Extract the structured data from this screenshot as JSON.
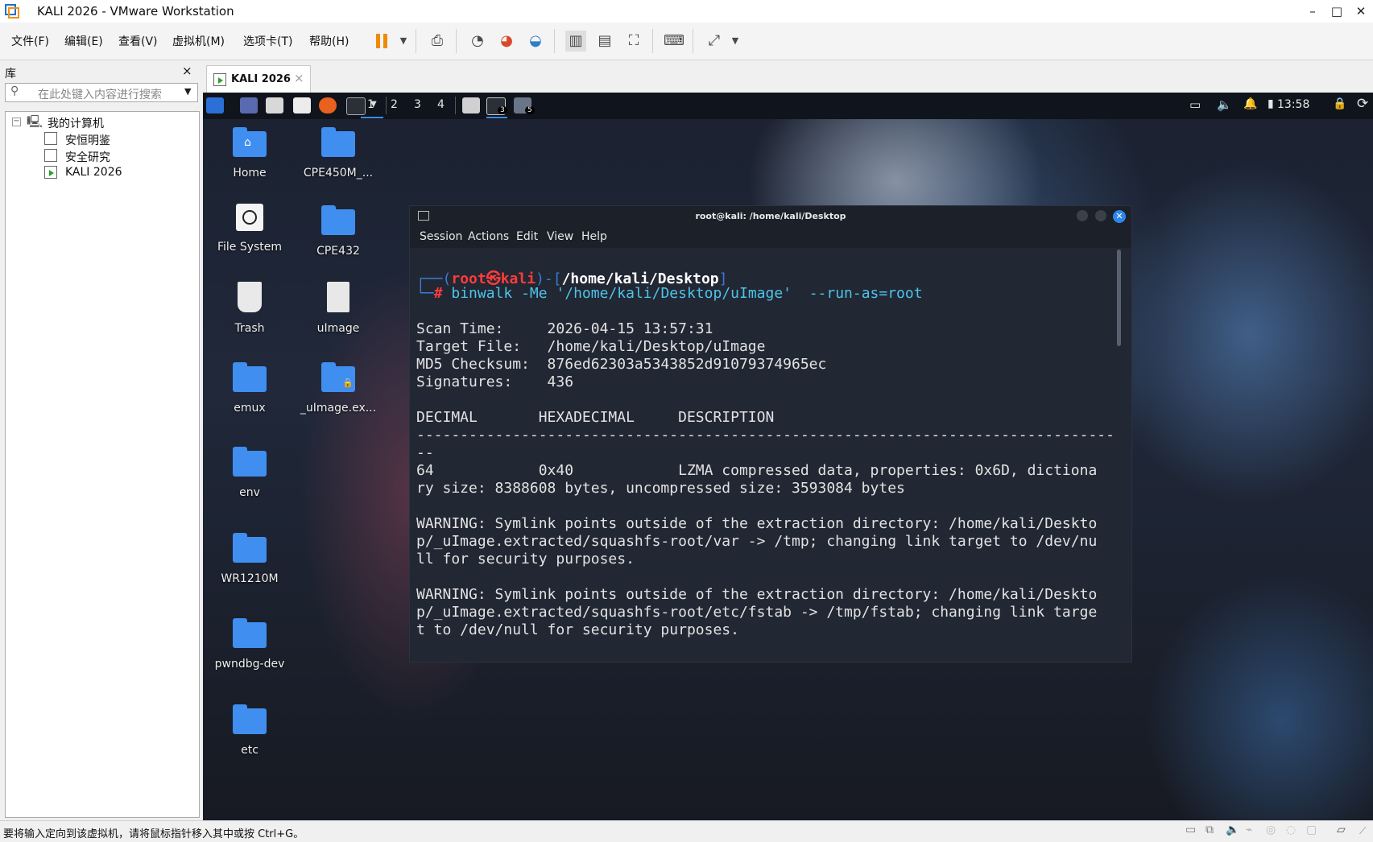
{
  "window": {
    "title": "KALI 2026 - VMware Workstation"
  },
  "menu": {
    "items": [
      "文件(F)",
      "编辑(E)",
      "查看(V)",
      "虚拟机(M)",
      "选项卡(T)",
      "帮助(H)"
    ]
  },
  "library": {
    "title": "库",
    "close": "×",
    "search_placeholder": "在此处键入内容进行搜索",
    "tree": {
      "root": "我的计算机",
      "children": [
        "安恒明鉴",
        "安全研究",
        "KALI 2026"
      ]
    }
  },
  "vm_tab": {
    "label": "KALI 2026",
    "close": "×"
  },
  "kali_panel": {
    "workspaces": [
      "1",
      "2",
      "3",
      "4"
    ],
    "clock": "13:58",
    "badges": [
      "3",
      "5"
    ]
  },
  "desktop_icons": [
    {
      "label": "Home"
    },
    {
      "label": "CPE450M_..."
    },
    {
      "label": "File System"
    },
    {
      "label": "CPE432"
    },
    {
      "label": "Trash"
    },
    {
      "label": "uImage"
    },
    {
      "label": "emux"
    },
    {
      "label": "_uImage.ex..."
    },
    {
      "label": "env"
    },
    {
      "label": "WR1210M"
    },
    {
      "label": "pwndbg-dev"
    },
    {
      "label": "etc"
    }
  ],
  "terminal": {
    "title": "root@kali: /home/kali/Desktop",
    "menu": [
      "Session",
      "Actions",
      "Edit",
      "View",
      "Help"
    ],
    "prompt_user": "root㉿kali",
    "prompt_path": "/home/kali/Desktop",
    "command": "binwalk -Me '/home/kali/Desktop/uImage'  --run-as=root",
    "lines": [
      "Scan Time:     2026-04-15 13:57:31",
      "Target File:   /home/kali/Desktop/uImage",
      "MD5 Checksum:  876ed62303a5343852d91079374965ec",
      "Signatures:    436",
      "",
      "DECIMAL       HEXADECIMAL     DESCRIPTION",
      "--------------------------------------------------------------------------------",
      "--",
      "64            0x40            LZMA compressed data, properties: 0x6D, dictiona",
      "ry size: 8388608 bytes, uncompressed size: 3593084 bytes",
      "",
      "WARNING: Symlink points outside of the extraction directory: /home/kali/Deskto",
      "p/_uImage.extracted/squashfs-root/var -> /tmp; changing link target to /dev/nu",
      "ll for security purposes.",
      "",
      "WARNING: Symlink points outside of the extraction directory: /home/kali/Deskto",
      "p/_uImage.extracted/squashfs-root/etc/fstab -> /tmp/fstab; changing link targe",
      "t to /dev/null for security purposes."
    ]
  },
  "statusbar": {
    "text": "要将输入定向到该虚拟机，请将鼠标指针移入其中或按 Ctrl+G。"
  },
  "colors": {
    "accent": "#3f8ef0",
    "prompt_red": "#ff3c3c",
    "prompt_blue": "#3a7bd5",
    "command_cyan": "#4fc3e8"
  }
}
